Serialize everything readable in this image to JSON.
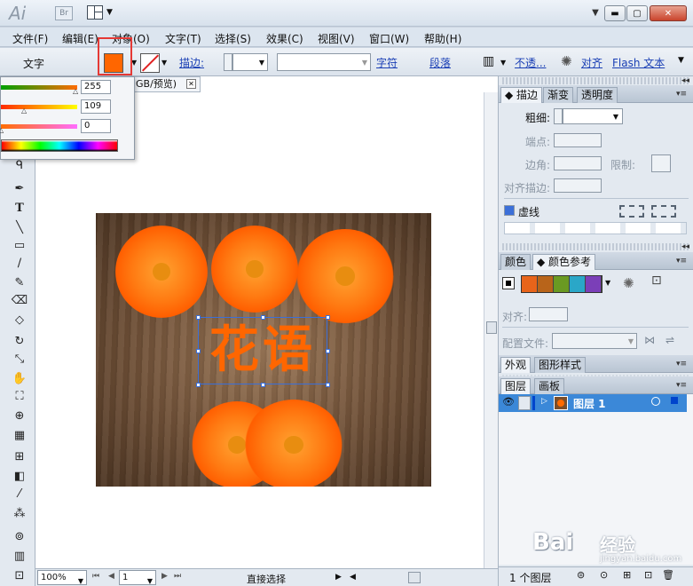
{
  "app": {
    "logo": "Ai",
    "bridge": "Br"
  },
  "menu": [
    "文件(F)",
    "编辑(E)",
    "对象(O)",
    "文字(T)",
    "选择(S)",
    "效果(C)",
    "视图(V)",
    "窗口(W)",
    "帮助(H)"
  ],
  "control": {
    "mode_label": "文字",
    "fill_color": "#ff6600",
    "stroke_label": "描边:",
    "char_link": "字符",
    "para_link": "段落",
    "opacity_link": "不透...",
    "align_link": "对齐",
    "flash_link": "Flash 文本"
  },
  "color_popover": {
    "r": "255",
    "g": "109",
    "b": "0"
  },
  "document": {
    "tab_label": "GB/预览)",
    "artboard_text": "花语"
  },
  "status": {
    "zoom": "100%",
    "page": "1",
    "tool_name": "直接选择"
  },
  "stroke_panel": {
    "tabs": [
      "描边",
      "渐变",
      "透明度"
    ],
    "weight_label": "粗细:",
    "cap_label": "端点:",
    "corner_label": "边角:",
    "limit_label": "限制:",
    "align_label": "对齐描边:",
    "dashed_label": "虚线"
  },
  "color_panel": {
    "tabs": [
      "颜色",
      "颜色参考"
    ],
    "swatches": [
      "#e8641a",
      "#b8641a",
      "#6a9a22",
      "#2aa7c8",
      "#7b3fb8"
    ]
  },
  "align_panel": {
    "label": "对齐:"
  },
  "profile": {
    "label": "配置文件:"
  },
  "appearance_panel": {
    "tabs": [
      "外观",
      "图形样式"
    ]
  },
  "layers_panel": {
    "tabs": [
      "图层",
      "画板"
    ],
    "layer_name": "图层 1",
    "footer": "1 个图层"
  },
  "watermark": {
    "brand": "Bai",
    "brand_cn": "经验",
    "url": "jingyan.baidu.com"
  }
}
